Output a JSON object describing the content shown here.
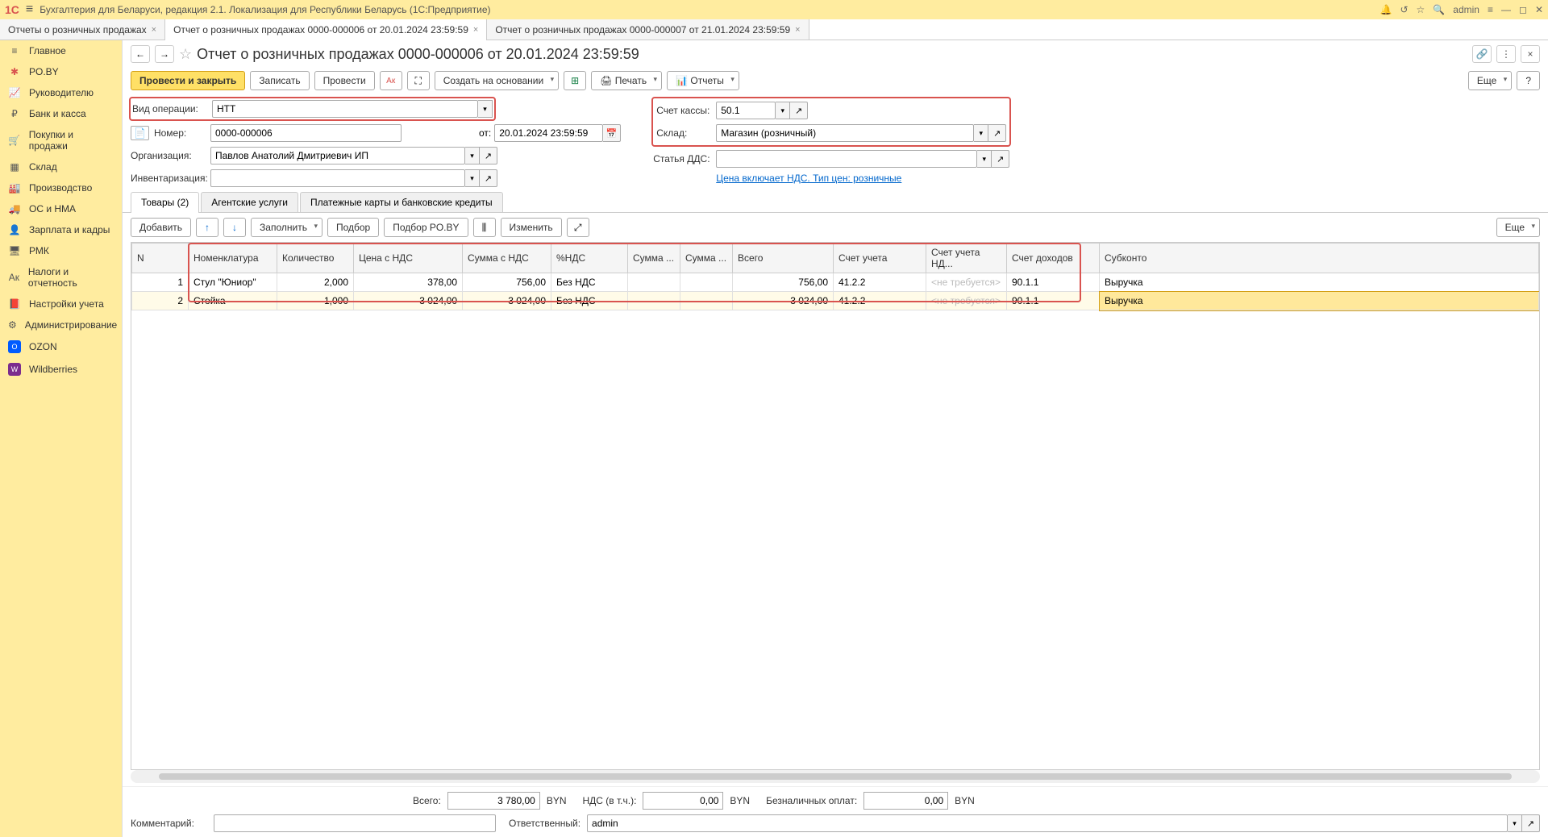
{
  "app": {
    "title": "Бухгалтерия для Беларуси, редакция 2.1. Локализация для Республики Беларусь   (1С:Предприятие)",
    "user": "admin"
  },
  "window_tabs": [
    {
      "label": "Отчеты о розничных продажах"
    },
    {
      "label": "Отчет о розничных продажах 0000-000006 от 20.01.2024 23:59:59"
    },
    {
      "label": "Отчет о розничных продажах 0000-000007 от 21.01.2024 23:59:59"
    }
  ],
  "sidebar": {
    "items": [
      {
        "label": "Главное"
      },
      {
        "label": "PO.BY"
      },
      {
        "label": "Руководителю"
      },
      {
        "label": "Банк и касса"
      },
      {
        "label": "Покупки и продажи"
      },
      {
        "label": "Склад"
      },
      {
        "label": "Производство"
      },
      {
        "label": "ОС и НМА"
      },
      {
        "label": "Зарплата и кадры"
      },
      {
        "label": "РМК"
      },
      {
        "label": "Налоги и отчетность"
      },
      {
        "label": "Настройки учета"
      },
      {
        "label": "Администрирование"
      },
      {
        "label": "OZON"
      },
      {
        "label": "Wildberries"
      }
    ]
  },
  "doc": {
    "title": "Отчет о розничных продажах 0000-000006 от 20.01.2024 23:59:59",
    "toolbar": {
      "post_close": "Провести и закрыть",
      "save": "Записать",
      "post": "Провести",
      "create_based": "Создать на основании",
      "print": "Печать",
      "reports": "Отчеты",
      "more": "Еще"
    },
    "labels": {
      "op_type": "Вид операции:",
      "number": "Номер:",
      "from": "от:",
      "org": "Организация:",
      "inventory": "Инвентаризация:",
      "cash_account": "Счет кассы:",
      "warehouse": "Склад:",
      "dds": "Статья ДДС:",
      "price_link": "Цена включает НДС. Тип цен: розничные"
    },
    "values": {
      "op_type": "НТТ",
      "number": "0000-000006",
      "date": "20.01.2024 23:59:59",
      "org": "Павлов Анатолий Дмитриевич ИП",
      "inventory": "",
      "cash_account": "50.1",
      "warehouse": "Магазин (розничный)",
      "dds": ""
    },
    "tabs": [
      {
        "label": "Товары (2)"
      },
      {
        "label": "Агентские услуги"
      },
      {
        "label": "Платежные карты и банковские кредиты"
      }
    ],
    "table_toolbar": {
      "add": "Добавить",
      "fill": "Заполнить",
      "select": "Подбор",
      "select_poby": "Подбор PO.BY",
      "change": "Изменить",
      "more": "Еще"
    },
    "columns": [
      "N",
      "Номенклатура",
      "Количество",
      "Цена с НДС",
      "Сумма с НДС",
      "%НДС",
      "Сумма ...",
      "Сумма ...",
      "Всего",
      "Счет учета",
      "Счет учета НД...",
      "Счет доходов",
      "Субконто"
    ],
    "rows": [
      {
        "n": "1",
        "nom": "Стул \"Юниор\"",
        "qty": "2,000",
        "price": "378,00",
        "sum": "756,00",
        "vat": "Без НДС",
        "vatsum1": "",
        "vatsum2": "",
        "total": "756,00",
        "acc": "41.2.2",
        "acc_vat": "<не требуется>",
        "acc_income": "90.1.1",
        "sub": "Выручка"
      },
      {
        "n": "2",
        "nom": "Стойка",
        "qty": "1,000",
        "price": "3 024,00",
        "sum": "3 024,00",
        "vat": "Без НДС",
        "vatsum1": "",
        "vatsum2": "",
        "total": "3 024,00",
        "acc": "41.2.2",
        "acc_vat": "<не требуется>",
        "acc_income": "90.1.1",
        "sub": "Выручка"
      }
    ],
    "footer": {
      "total_label": "Всего:",
      "total_value": "3 780,00",
      "currency": "BYN",
      "vat_label": "НДС (в т.ч.):",
      "vat_value": "0,00",
      "cashless_label": "Безналичных оплат:",
      "cashless_value": "0,00",
      "comment_label": "Комментарий:",
      "comment_value": "",
      "responsible_label": "Ответственный:",
      "responsible_value": "admin"
    }
  }
}
